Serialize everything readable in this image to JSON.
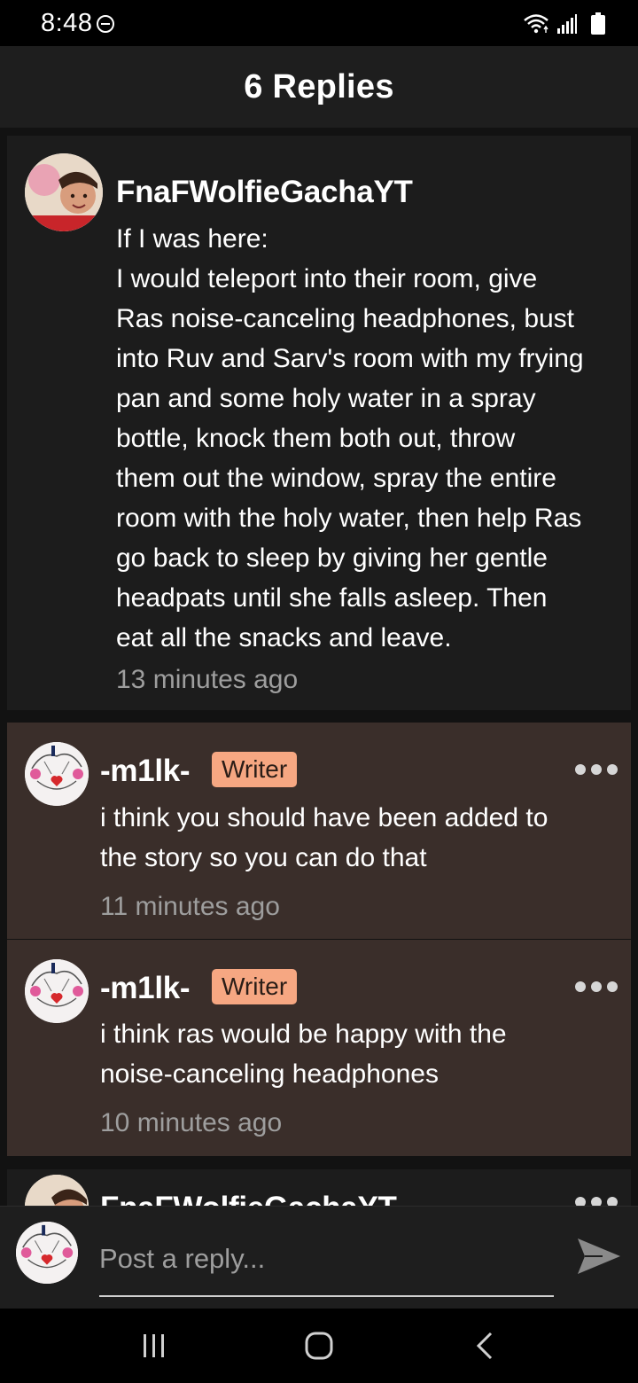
{
  "status_bar": {
    "time": "8:48",
    "icons": [
      "do-not-disturb-icon",
      "wifi-icon",
      "signal-icon",
      "battery-icon"
    ]
  },
  "header": {
    "title": "6 Replies"
  },
  "main_comment": {
    "username": "FnaFWolfieGachaYT",
    "lines": [
      "If I was here:",
      "I would teleport into their room, give",
      "Ras noise-canceling headphones, bust",
      "into Ruv and Sarv's room with my frying",
      "pan and some holy water in a spray",
      "bottle, knock them both out, throw",
      "them out the window, spray the entire",
      "room with the holy water, then help Ras",
      "go back to sleep by giving her gentle",
      "headpats until she falls asleep. Then",
      "eat all the snacks and leave."
    ],
    "timestamp": "13 minutes ago"
  },
  "replies": [
    {
      "username": "-m1lk-",
      "badge": "Writer",
      "lines": [
        "i think you should have been added to",
        "the story so you can do that"
      ],
      "timestamp": "11 minutes ago"
    },
    {
      "username": "-m1lk-",
      "badge": "Writer",
      "lines": [
        "i think ras would be happy with the",
        "noise-canceling headphones"
      ],
      "timestamp": "10 minutes ago"
    }
  ],
  "partial_reply": {
    "username": "FnaFWolfieGachaYT"
  },
  "reply_bar": {
    "placeholder": "Post a reply..."
  },
  "colors": {
    "writer_badge": "#f6a782",
    "reply_card": "#3a2e2a",
    "main_card": "#1c1c1c",
    "timestamp": "#9e9e9e"
  }
}
